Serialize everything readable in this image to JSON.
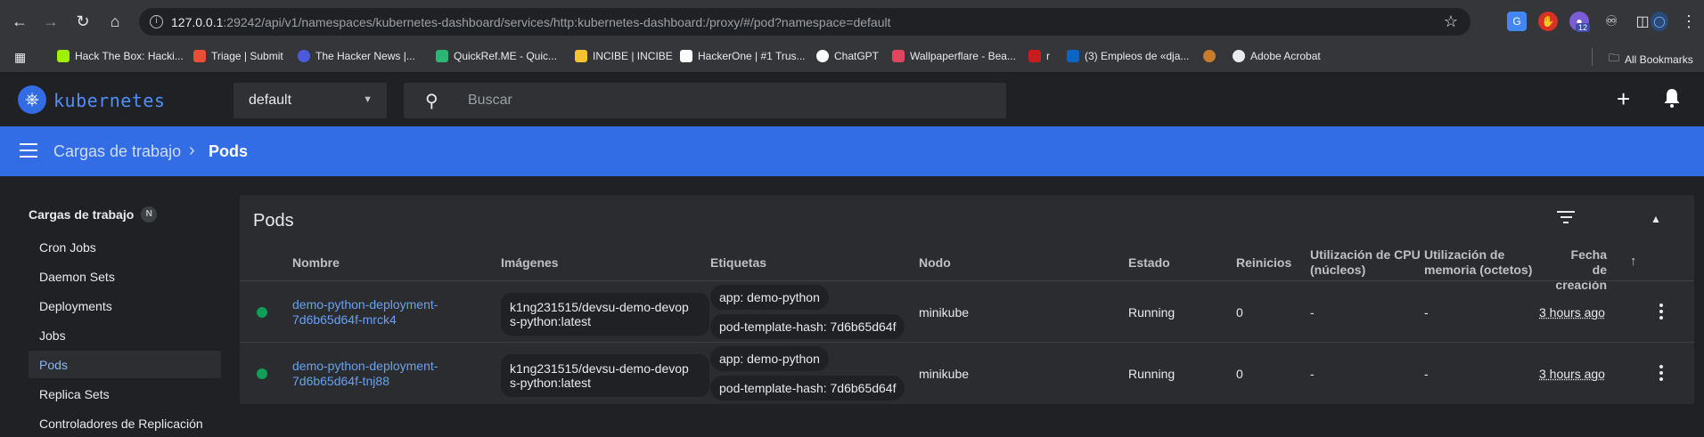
{
  "browser": {
    "url_host": "127.0.0.1",
    "url_path": ":29242/api/v1/namespaces/kubernetes-dashboard/services/http:kubernetes-dashboard:/proxy/#/pod?namespace=default",
    "extension_badge": "12",
    "bookmarks": [
      {
        "label": "Hack The Box: Hacki...",
        "color": "#9fef00"
      },
      {
        "label": "Triage | Submit",
        "color": "#e94f37"
      },
      {
        "label": "The Hacker News |...",
        "color": "#4b5bdc"
      },
      {
        "label": "QuickRef.ME - Quic...",
        "color": "#2bb673"
      },
      {
        "label": "INCIBE | INCIBE",
        "color": "#f2c230"
      },
      {
        "label": "HackerOne | #1 Trus...",
        "color": "#ffffff"
      },
      {
        "label": "ChatGPT",
        "color": "#ffffff"
      },
      {
        "label": "Wallpaperflare - Bea...",
        "color": "#e0455f"
      },
      {
        "label": "r",
        "color": "#c91d1d"
      },
      {
        "label": "(3) Empleos de «dja...",
        "color": "#0a66c2"
      },
      {
        "label": "",
        "color": "#c77b2e"
      },
      {
        "label": "Adobe Acrobat",
        "color": "#e8eaed"
      }
    ],
    "all_bookmarks": "All Bookmarks"
  },
  "header": {
    "logo_text": "kubernetes",
    "namespace": "default",
    "search_placeholder": "Buscar"
  },
  "toolbar": {
    "breadcrumb_parent": "Cargas de trabajo",
    "breadcrumb_current": "Pods"
  },
  "sidebar": {
    "section_title": "Cargas de trabajo",
    "section_badge": "N",
    "items": [
      {
        "label": "Cron Jobs"
      },
      {
        "label": "Daemon Sets"
      },
      {
        "label": "Deployments"
      },
      {
        "label": "Jobs"
      },
      {
        "label": "Pods"
      },
      {
        "label": "Replica Sets"
      },
      {
        "label": "Controladores de Replicación"
      }
    ]
  },
  "pods_card": {
    "title": "Pods",
    "columns": {
      "name": "Nombre",
      "images": "Imágenes",
      "labels": "Etiquetas",
      "node": "Nodo",
      "status": "Estado",
      "restarts": "Reinicios",
      "cpu_1": "Utilización de CPU",
      "cpu_2": "(núcleos)",
      "mem_1": "Utilización de",
      "mem_2": "memoria (octetos)",
      "created_1": "Fecha de",
      "created_2": "creación"
    },
    "rows": [
      {
        "name_1": "demo-python-deployment-",
        "name_2": "7d6b65d64f-mrck4",
        "image_1": "k1ng231515/devsu-demo-devop",
        "image_2": "s-python:latest",
        "label_app": "app: demo-python",
        "label_hash": "pod-template-hash: 7d6b65d64f",
        "node": "minikube",
        "status": "Running",
        "restarts": "0",
        "cpu": "-",
        "memory": "-",
        "created": "3 hours ago"
      },
      {
        "name_1": "demo-python-deployment-",
        "name_2": "7d6b65d64f-tnj88",
        "image_1": "k1ng231515/devsu-demo-devop",
        "image_2": "s-python:latest",
        "label_app": "app: demo-python",
        "label_hash": "pod-template-hash: 7d6b65d64f",
        "node": "minikube",
        "status": "Running",
        "restarts": "0",
        "cpu": "-",
        "memory": "-",
        "created": "3 hours ago"
      }
    ]
  }
}
